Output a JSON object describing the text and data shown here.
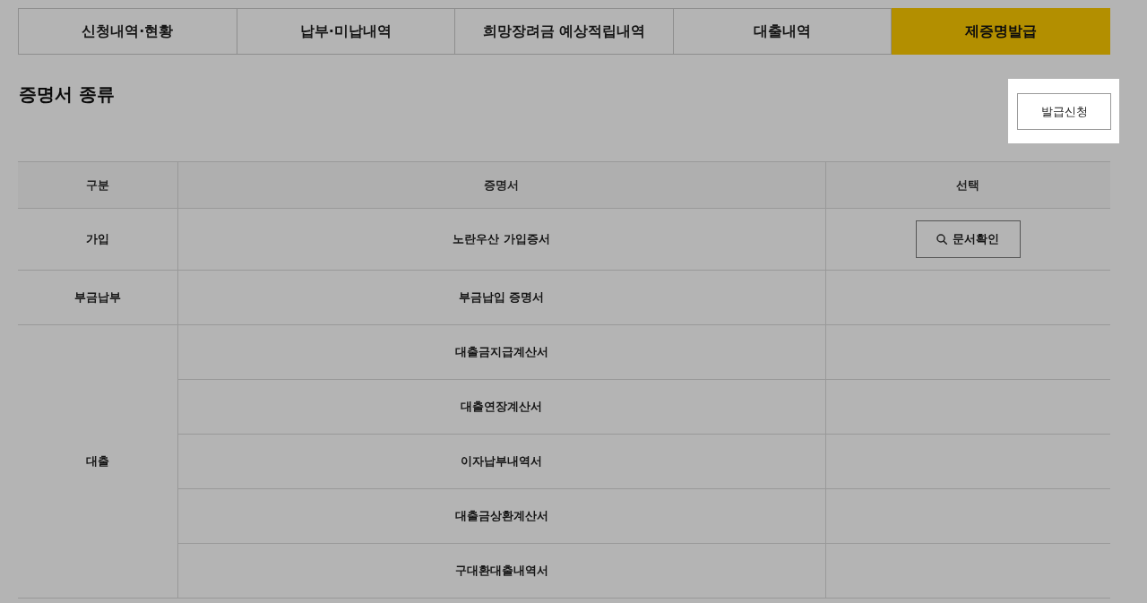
{
  "tabs": [
    {
      "label": "신청내역·현황",
      "selected": false
    },
    {
      "label": "납부·미납내역",
      "selected": false
    },
    {
      "label": "희망장려금 예상적립내역",
      "selected": false
    },
    {
      "label": "대출내역",
      "selected": false
    },
    {
      "label": "제증명발급",
      "selected": true
    }
  ],
  "section": {
    "title": "증명서 종류"
  },
  "issue_button": {
    "label": "발급신청",
    "highlighted": true
  },
  "table": {
    "columns": [
      "구분",
      "증명서",
      "선택"
    ],
    "groups": [
      {
        "category": "가입",
        "rows": [
          {
            "certificate": "노란우산 가입증서",
            "action": "문서확인"
          }
        ]
      },
      {
        "category": "부금납부",
        "rows": [
          {
            "certificate": "부금납입 증명서"
          }
        ]
      },
      {
        "category": "대출",
        "rows": [
          {
            "certificate": "대출금지급계산서"
          },
          {
            "certificate": "대출연장계산서"
          },
          {
            "certificate": "이자납부내역서"
          },
          {
            "certificate": "대출금상환계산서"
          },
          {
            "certificate": "구대환대출내역서"
          }
        ]
      }
    ]
  }
}
